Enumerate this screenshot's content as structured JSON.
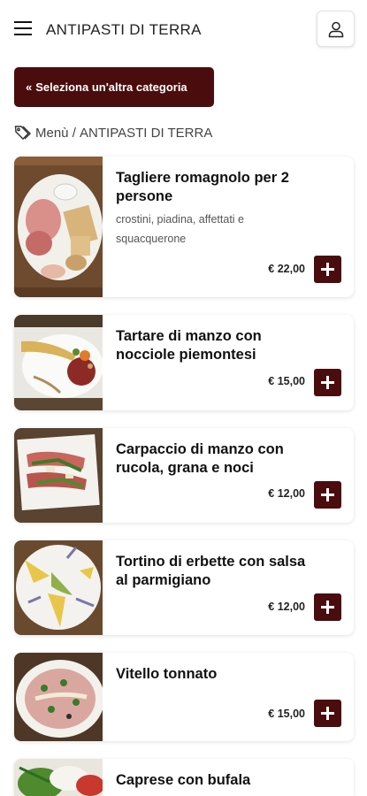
{
  "header": {
    "title": "ANTIPASTI DI TERRA"
  },
  "category_button": {
    "icon": "chevrons-left-icon",
    "label": "Seleziona un'altra categoria"
  },
  "breadcrumb": {
    "icon": "tag-icon",
    "home": "Menù",
    "separator": " / ",
    "current": "ANTIPASTI DI TERRA"
  },
  "colors": {
    "accent": "#4a0c0c"
  },
  "items": [
    {
      "name": "Tagliere romagnolo per 2 persone",
      "description": "crostini, piadina, affettati e squacquerone",
      "price": "€ 22,00"
    },
    {
      "name": "Tartare di manzo con nocciole piemontesi",
      "description": "",
      "price": "€ 15,00"
    },
    {
      "name": "Carpaccio di manzo con rucola, grana e noci",
      "description": "",
      "price": "€ 12,00"
    },
    {
      "name": "Tortino di erbette con salsa al parmigiano",
      "description": "",
      "price": "€ 12,00"
    },
    {
      "name": "Vitello tonnato",
      "description": "",
      "price": "€ 15,00"
    },
    {
      "name": "Caprese con bufala",
      "description": "",
      "price": ""
    }
  ]
}
